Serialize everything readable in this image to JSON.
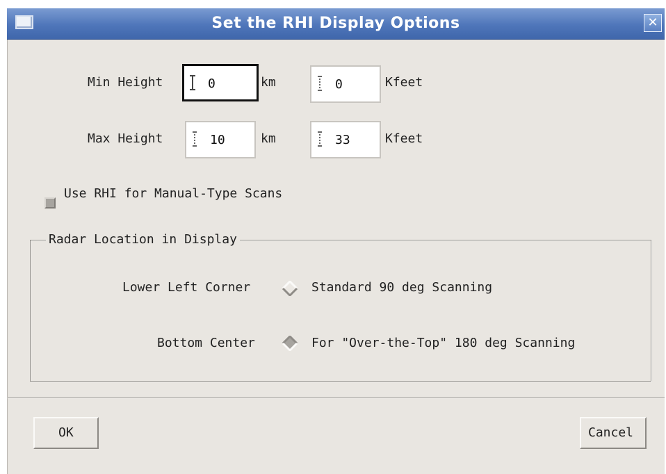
{
  "window": {
    "title": "Set the RHI Display Options",
    "close_glyph": "✕"
  },
  "heights": {
    "min_label": "Min Height",
    "max_label": "Max Height",
    "min_km": "0",
    "min_kfeet": "0",
    "max_km": "10",
    "max_kfeet": "33",
    "km_unit": "km",
    "kfeet_unit": "Kfeet"
  },
  "options": {
    "manual_scans_label": "Use RHI for Manual-Type Scans",
    "manual_scans_checked": false
  },
  "radar_location": {
    "group_title": "Radar Location in Display",
    "lower_left_label": "Lower Left Corner",
    "lower_left_desc": "Standard 90 deg Scanning",
    "bottom_center_label": "Bottom Center",
    "bottom_center_desc": "For \"Over-the-Top\" 180 deg Scanning",
    "selected": "bottom_center"
  },
  "buttons": {
    "ok": "OK",
    "cancel": "Cancel"
  },
  "icons": {
    "menu": "window-menu-icon",
    "close": "close-icon",
    "radio": "diamond-radio-icon"
  }
}
